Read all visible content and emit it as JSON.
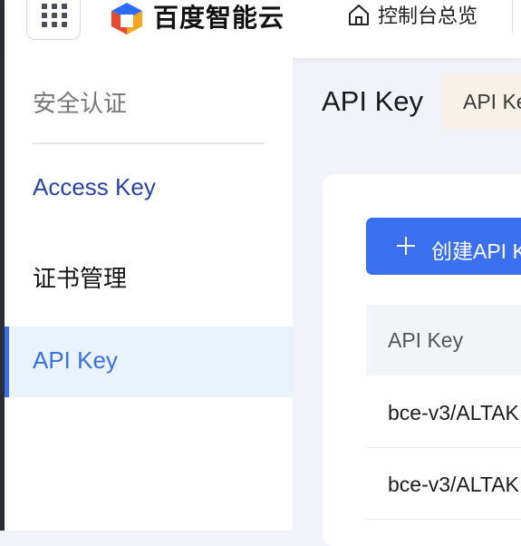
{
  "header": {
    "brand_name": "百度智能云",
    "console_link_label": "控制台总览",
    "icons": [
      "app-grid-icon",
      "baidu-cloud-logo-icon",
      "home-icon"
    ]
  },
  "sidebar": {
    "section_title": "安全认证",
    "items": [
      {
        "label": "Access Key",
        "active": false
      },
      {
        "label": "证书管理",
        "active": false
      },
      {
        "label": "API Key",
        "active": true
      }
    ]
  },
  "main": {
    "page_title": "API Key",
    "tab_label": "API Key",
    "create_button_label": "创建API Key",
    "table": {
      "columns": [
        "API Key"
      ],
      "rows": [
        [
          "bce-v3/ALTAK"
        ],
        [
          "bce-v3/ALTAK"
        ]
      ]
    }
  },
  "colors": {
    "accent": "#3a6ff0",
    "active_nav_bg": "#eaf2fd",
    "tab_bg": "#f7f1ea",
    "page_bg": "#f1f3f8"
  }
}
